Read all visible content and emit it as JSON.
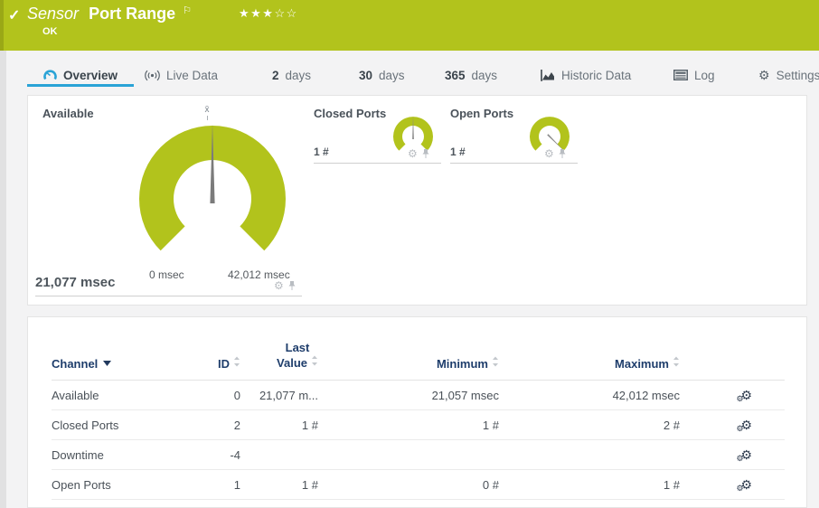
{
  "header": {
    "check_icon": "✓",
    "sensor_label": "Sensor",
    "sensor_name": "Port Range",
    "flag_icon": "⚐",
    "stars_filled": "★★★",
    "stars_empty": "☆☆",
    "status": "OK"
  },
  "tabs": {
    "overview": "Overview",
    "live_data": "Live Data",
    "d2_num": "2",
    "d2_word": "days",
    "d30_num": "30",
    "d30_word": "days",
    "d365_num": "365",
    "d365_word": "days",
    "historic": "Historic Data",
    "log": "Log",
    "settings": "Settings",
    "settings_gear": "⚙"
  },
  "gauges": {
    "available": {
      "label": "Available",
      "value": "21,077 msec",
      "min_label": "0 msec",
      "max_label": "42,012 msec",
      "avg_marker": "x̄",
      "needle_deg": 0,
      "gear_icon": "⚙"
    },
    "closed_ports": {
      "label": "Closed Ports",
      "value": "1 #",
      "needle_deg": 0,
      "gear_icon": "⚙"
    },
    "open_ports": {
      "label": "Open Ports",
      "value": "1 #",
      "needle_deg": 135,
      "gear_icon": "⚙"
    }
  },
  "table": {
    "headers": {
      "channel": "Channel",
      "id": "ID",
      "last_line1": "Last",
      "last_line2": "Value",
      "minimum": "Minimum",
      "maximum": "Maximum"
    },
    "gear_icon": "⚙",
    "rows": [
      {
        "channel": "Available",
        "id": "0",
        "last_value": "21,077 m...",
        "minimum": "21,057 msec",
        "maximum": "42,012 msec"
      },
      {
        "channel": "Closed Ports",
        "id": "2",
        "last_value": "1 #",
        "minimum": "1 #",
        "maximum": "2 #"
      },
      {
        "channel": "Downtime",
        "id": "-4",
        "last_value": "",
        "minimum": "",
        "maximum": ""
      },
      {
        "channel": "Open Ports",
        "id": "1",
        "last_value": "1 #",
        "minimum": "0 #",
        "maximum": "1 #"
      }
    ]
  },
  "colors": {
    "status_green": "#b2c31c",
    "accent_blue": "#2aa3d6",
    "header_navy": "#1e3d6b"
  }
}
